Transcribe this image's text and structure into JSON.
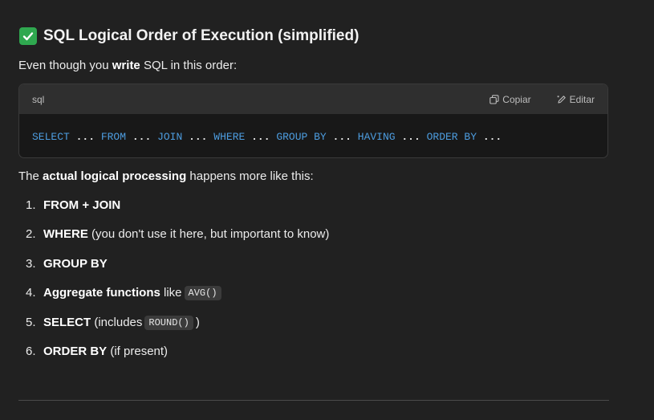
{
  "heading": {
    "icon": "check-mark-icon",
    "accent_color": "#2fa84f",
    "text": "SQL Logical Order of Execution (simplified)"
  },
  "intro": {
    "prefix": "Even though you ",
    "bold": "write",
    "suffix": " SQL in this order:"
  },
  "code_block": {
    "language": "sql",
    "copy_label": "Copiar",
    "edit_label": "Editar",
    "tokens": [
      {
        "t": "SELECT",
        "kw": true
      },
      {
        "t": " ... ",
        "kw": false
      },
      {
        "t": "FROM",
        "kw": true
      },
      {
        "t": " ... ",
        "kw": false
      },
      {
        "t": "JOIN",
        "kw": true
      },
      {
        "t": " ... ",
        "kw": false
      },
      {
        "t": "WHERE",
        "kw": true
      },
      {
        "t": " ... ",
        "kw": false
      },
      {
        "t": "GROUP BY",
        "kw": true
      },
      {
        "t": " ... ",
        "kw": false
      },
      {
        "t": "HAVING",
        "kw": true
      },
      {
        "t": " ... ",
        "kw": false
      },
      {
        "t": "ORDER BY",
        "kw": true
      },
      {
        "t": " ...",
        "kw": false
      }
    ]
  },
  "paragraph2": {
    "prefix": "The ",
    "bold": "actual logical processing",
    "suffix": " happens more like this:"
  },
  "steps": [
    {
      "num": "1.",
      "bold": "FROM + JOIN",
      "rest": "",
      "code": "",
      "after": ""
    },
    {
      "num": "2.",
      "bold": "WHERE",
      "rest": " (you don't use it here, but important to know)",
      "code": "",
      "after": ""
    },
    {
      "num": "3.",
      "bold": "GROUP BY",
      "rest": "",
      "code": "",
      "after": ""
    },
    {
      "num": "4.",
      "bold": "Aggregate functions",
      "rest": " like",
      "code": "AVG()",
      "after": ""
    },
    {
      "num": "5.",
      "bold": "SELECT",
      "rest": " (includes",
      "code": "ROUND()",
      "after": ")"
    },
    {
      "num": "6.",
      "bold": "ORDER BY",
      "rest": " (if present)",
      "code": "",
      "after": ""
    }
  ]
}
